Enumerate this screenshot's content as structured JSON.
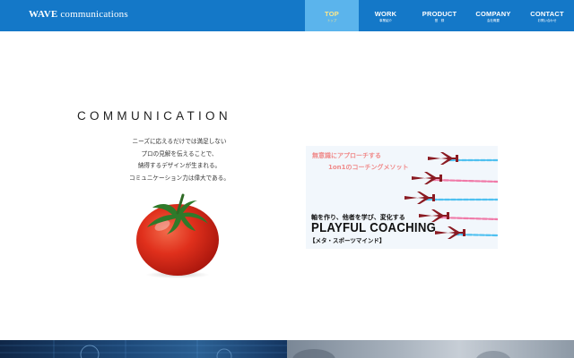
{
  "header": {
    "logo_wave": "WAVE",
    "logo_rest": " communications",
    "nav": [
      {
        "label": "TOP",
        "sub": "トップ"
      },
      {
        "label": "WORK",
        "sub": "事業紹介"
      },
      {
        "label": "PRODUCT",
        "sub": "登　録"
      },
      {
        "label": "COMPANY",
        "sub": "会社概要"
      },
      {
        "label": "CONTACT",
        "sub": "お問い合わせ"
      }
    ]
  },
  "main": {
    "headline": "COMMUNICATION",
    "copy": [
      "ニーズに応えるだけでは満足しない",
      "プロの見解を伝えることで、",
      "納得するデザインが生まれる。",
      "コミュニケーション力は偉大である。"
    ],
    "banner": {
      "line1": "無意識にアプローチする",
      "line2": "1on1のコーチングメソット",
      "line3": "軸を作り、他者を学び、変化する",
      "title": "PLAYFUL COACHING",
      "subtitle": "【メタ・スポーツマインド】"
    }
  },
  "colors": {
    "header_bg": "#1478c8",
    "nav_active_bg": "#5bb4ec",
    "nav_active_text": "#ffe98a",
    "banner_accent": "#f08a8a"
  }
}
